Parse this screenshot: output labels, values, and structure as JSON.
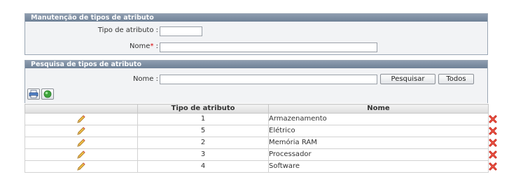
{
  "maintenance_panel": {
    "title": "Manutenção de tipos de atributo",
    "type_label": "Tipo de atributo :",
    "type_value": "",
    "name_label": "Nome",
    "name_required_mark": "*",
    "name_colon": " :",
    "name_value": ""
  },
  "search_panel": {
    "title": "Pesquisa de tipos de atributo",
    "name_label": "Nome :",
    "name_value": "",
    "search_button": "Pesquisar",
    "all_button": "Todos"
  },
  "toolbar": {
    "print_icon": "printer-icon",
    "refresh_icon": "green-circle-icon"
  },
  "grid": {
    "columns": [
      "",
      "Tipo de atributo",
      "Nome",
      ""
    ],
    "rows": [
      {
        "type": "1",
        "name": "Armazenamento"
      },
      {
        "type": "5",
        "name": "Elétrico"
      },
      {
        "type": "2",
        "name": "Memória RAM"
      },
      {
        "type": "3",
        "name": "Processador"
      },
      {
        "type": "4",
        "name": "Software"
      }
    ],
    "edit_icon": "pencil-icon",
    "delete_icon": "red-x-icon"
  },
  "colors": {
    "header_bg": "#7b8ca1",
    "panel_bg": "#f2f3f5",
    "required": "#d80000",
    "delete": "#d8251b",
    "pencil": "#e8b13a"
  }
}
